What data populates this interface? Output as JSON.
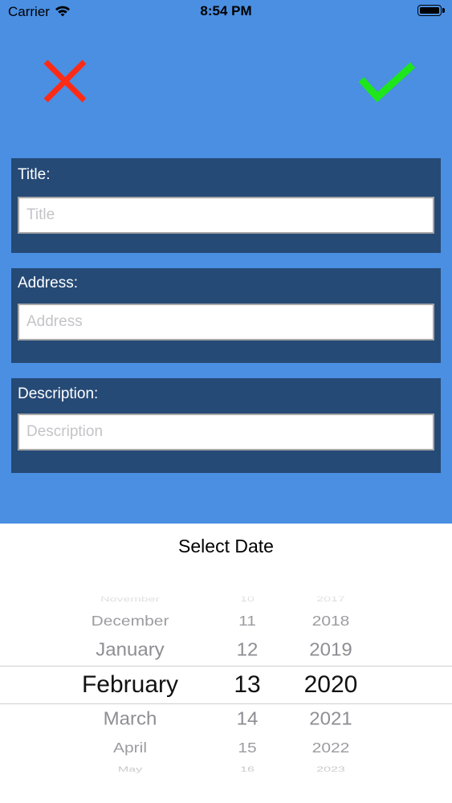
{
  "status_bar": {
    "carrier": "Carrier",
    "time": "8:54 PM"
  },
  "toolbar": {
    "cancel_icon": "close-icon",
    "confirm_icon": "checkmark-icon",
    "cancel_color": "#ff2b16",
    "confirm_color": "#1ee61a"
  },
  "form": {
    "title_label": "Title:",
    "title_placeholder": "Title",
    "address_label": "Address:",
    "address_placeholder": "Address",
    "description_label": "Description:",
    "description_placeholder": "Description"
  },
  "date_sheet": {
    "title": "Select Date",
    "months": [
      "November",
      "December",
      "January",
      "February",
      "March",
      "April",
      "May"
    ],
    "days": [
      "10",
      "11",
      "12",
      "13",
      "14",
      "15",
      "16"
    ],
    "years": [
      "2017",
      "2018",
      "2019",
      "2020",
      "2021",
      "2022",
      "2023"
    ],
    "selected": {
      "month": "February",
      "day": "13",
      "year": "2020"
    }
  },
  "colors": {
    "background": "#4a8fe2",
    "panel": "#264a76"
  }
}
